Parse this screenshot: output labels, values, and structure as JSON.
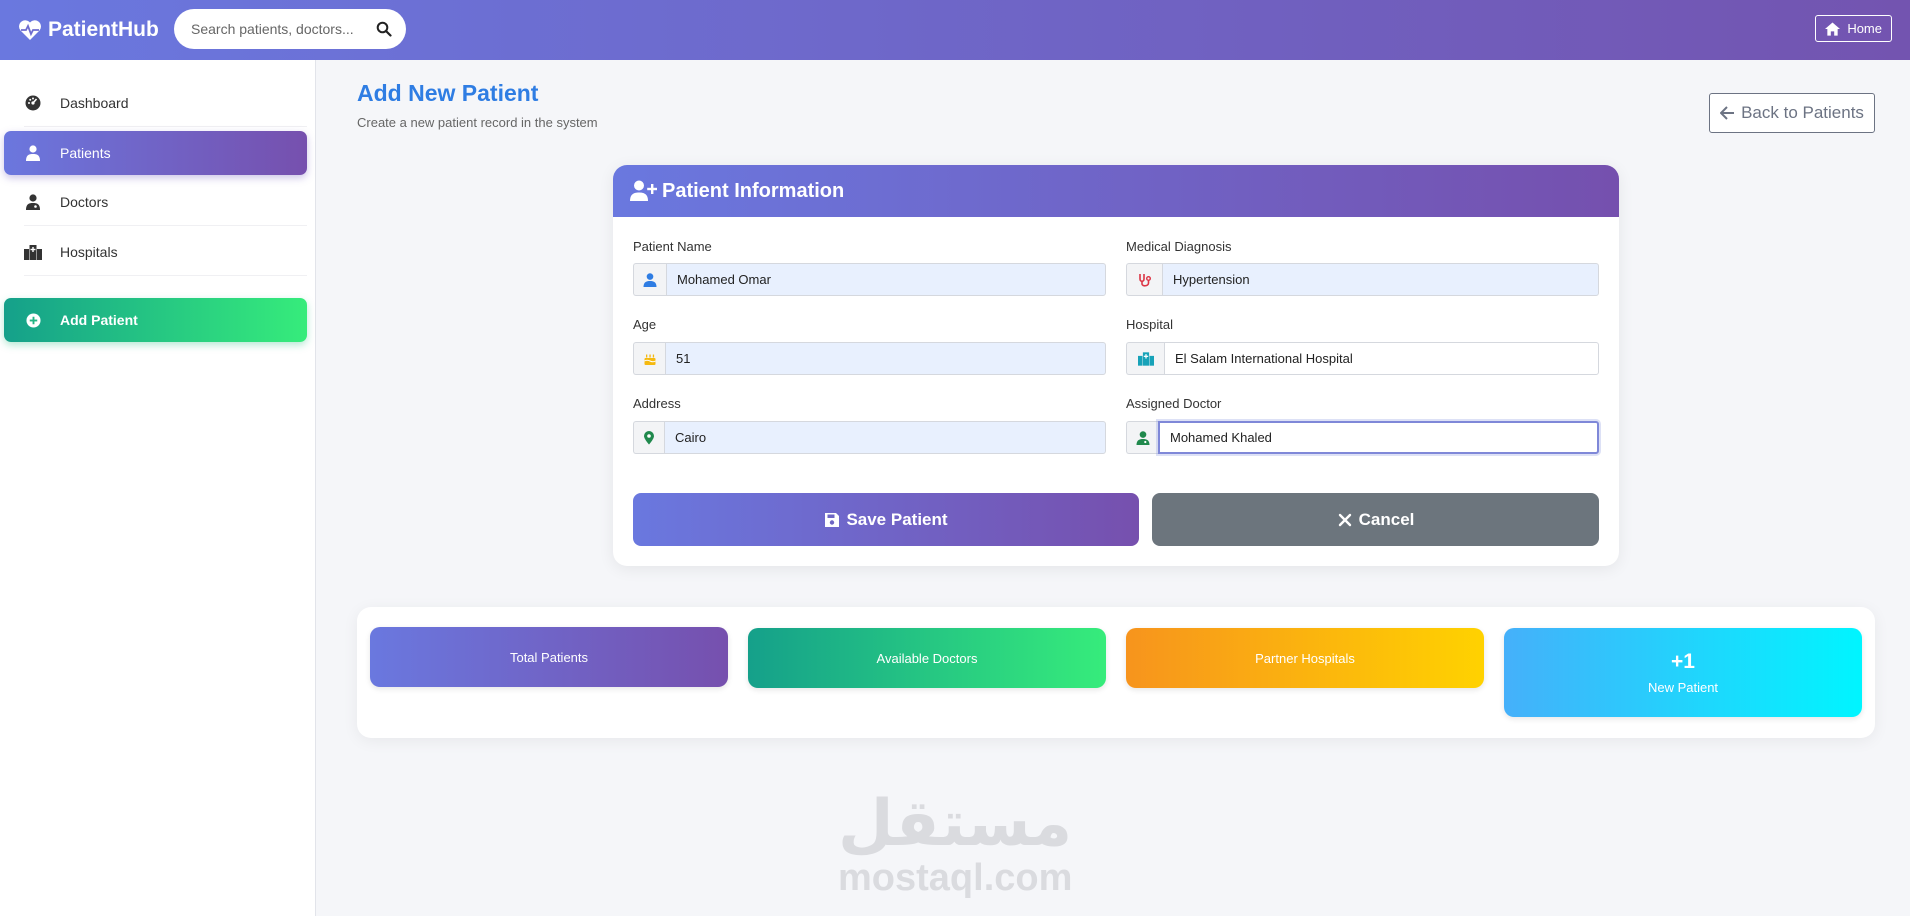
{
  "header": {
    "brand": "PatientHub",
    "search_placeholder": "Search patients, doctors...",
    "home_label": "Home"
  },
  "sidebar": {
    "items": [
      {
        "label": "Dashboard",
        "icon": "dashboard-icon",
        "active": false
      },
      {
        "label": "Patients",
        "icon": "user-injured-icon",
        "active": true
      },
      {
        "label": "Doctors",
        "icon": "user-doctor-icon",
        "active": false
      },
      {
        "label": "Hospitals",
        "icon": "hospital-icon",
        "active": false
      },
      {
        "label": "Add Patient",
        "icon": "plus-circle-icon",
        "active": false
      }
    ]
  },
  "page": {
    "title": "Add New Patient",
    "subtitle": "Create a new patient record in the system",
    "back_label": "Back to Patients"
  },
  "form": {
    "title": "Patient Information",
    "fields": {
      "patient_name": {
        "label": "Patient Name",
        "value": "Mohamed Omar",
        "icon": "user-icon"
      },
      "diagnosis": {
        "label": "Medical Diagnosis",
        "value": "Hypertension",
        "icon": "stethoscope-icon"
      },
      "age": {
        "label": "Age",
        "value": "51",
        "icon": "birthday-cake-icon"
      },
      "hospital": {
        "label": "Hospital",
        "value": "El Salam International Hospital",
        "icon": "hospital-icon"
      },
      "address": {
        "label": "Address",
        "value": "Cairo",
        "icon": "map-marker-icon"
      },
      "doctor": {
        "label": "Assigned Doctor",
        "value": "Mohamed Khaled",
        "icon": "user-doctor-icon"
      }
    },
    "save_label": "Save Patient",
    "cancel_label": "Cancel"
  },
  "stats": [
    {
      "label": "Total Patients",
      "value": ""
    },
    {
      "label": "Available Doctors",
      "value": ""
    },
    {
      "label": "Partner Hospitals",
      "value": ""
    },
    {
      "label": "New Patient",
      "value": "+1"
    }
  ],
  "watermark": {
    "arabic": "مستقل",
    "latin": "mostaql.com"
  },
  "colors": {
    "primary_gradient_start": "#6a78df",
    "primary_gradient_end": "#7650ae",
    "success_gradient_start": "#15a08a",
    "success_gradient_end": "#36ec7b",
    "warning_gradient_start": "#f7941d",
    "warning_gradient_end": "#ffd200",
    "info_gradient_start": "#45b0fa",
    "info_gradient_end": "#00f5ff",
    "title_blue": "#2f7de3",
    "cancel_gray": "#6c757d"
  }
}
